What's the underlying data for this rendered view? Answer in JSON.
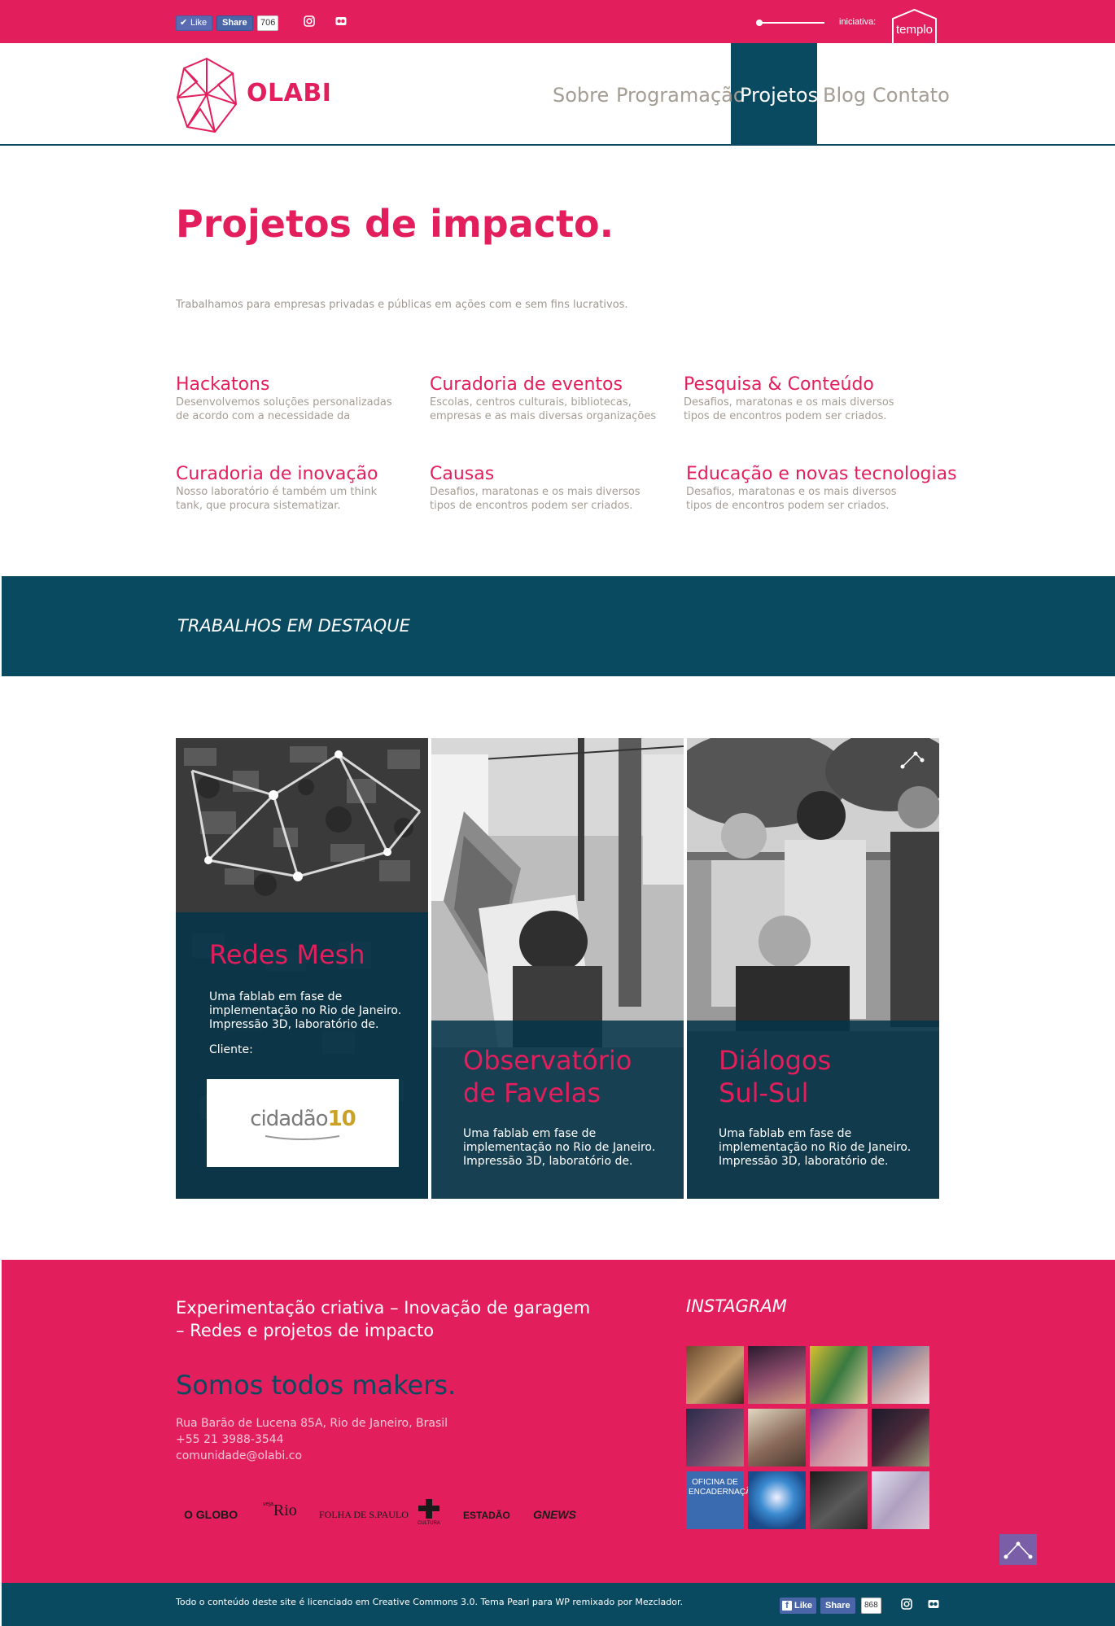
{
  "topbar": {
    "like_label": "Like",
    "share_label": "Share",
    "share_count": "706",
    "initiative_label": "iniciativa:",
    "initiative_logo_text": "templo",
    "icons": [
      "instagram-icon",
      "flickr-icon"
    ],
    "background": "#e31e5c"
  },
  "header": {
    "logo_text": "OLABI",
    "nav": [
      {
        "label": "Sobre",
        "active": false
      },
      {
        "label": "Programação",
        "active": false
      },
      {
        "label": "Projetos",
        "active": true
      },
      {
        "label": "Blog",
        "active": false
      },
      {
        "label": "Contato",
        "active": false
      }
    ],
    "active_color": "#0a4a60"
  },
  "intro": {
    "title": "Projetos de impacto.",
    "subtitle": "Trabalhamos para empresas privadas e públicas em ações com e sem fins lucrativos."
  },
  "services": [
    {
      "title": "Hackatons",
      "desc_lines": [
        "Desenvolvemos soluções personalizadas",
        "de acordo com a necessidade da"
      ]
    },
    {
      "title": "Curadoria de eventos",
      "desc_lines": [
        "Escolas, centros culturais, bibliotecas,",
        "empresas e as mais diversas organizações"
      ]
    },
    {
      "title": "Pesquisa & Conteúdo",
      "desc_lines": [
        "Desafios, maratonas e os mais diversos",
        "tipos de encontros podem ser criados."
      ]
    },
    {
      "title": "Curadoria de inovação",
      "desc_lines": [
        "Nosso laboratório é também um think",
        "tank, que procura sistematizar."
      ]
    },
    {
      "title": "Causas",
      "desc_lines": [
        "Desafios, maratonas e os mais diversos",
        "tipos de encontros podem ser criados."
      ]
    },
    {
      "title": "Educação e novas tecnologias",
      "desc_lines": [
        "Desafios, maratonas e os mais diversos",
        "tipos de encontros podem ser criados."
      ]
    }
  ],
  "featured": {
    "heading": "TRABALHOS EM DESTAQUE",
    "cards": [
      {
        "title_lines": [
          "Redes Mesh"
        ],
        "desc_lines": [
          "Uma fablab em fase de",
          "implementação no Rio de Janeiro.",
          "Impressão 3D, laboratório de."
        ],
        "client_label": "Cliente:",
        "client_logo": {
          "prefix": "cidadão",
          "suffix": "10"
        }
      },
      {
        "title_lines": [
          "Observatório",
          "de Favelas"
        ],
        "desc_lines": [
          "Uma fablab em fase de",
          "implementação no Rio de Janeiro.",
          "Impressão 3D, laboratório de."
        ]
      },
      {
        "title_lines": [
          "Diálogos",
          "Sul-Sul"
        ],
        "desc_lines": [
          "Uma fablab em fase de",
          "implementação no Rio de Janeiro.",
          "Impressão 3D, laboratório de."
        ]
      }
    ]
  },
  "footer": {
    "tagline_lines": [
      "Experimentação criativa – Inovação de garagem",
      "– Redes e projetos de impacto"
    ],
    "makers": "Somos todos makers.",
    "address": "Rua Barão de Lucena 85A, Rio de Janeiro, Brasil",
    "phone": "+55 21 3988-3544",
    "email": "comunidade@olabi.co",
    "press": [
      {
        "name": "O GLOBO",
        "prefix": ""
      },
      {
        "name": "Rio",
        "prefix": "veja"
      },
      {
        "name": "FOLHA DE S.PAULO",
        "prefix": ""
      },
      {
        "name": "CULTURA",
        "prefix": ""
      },
      {
        "name": "ESTADÃO",
        "prefix": ""
      },
      {
        "name": "NEWS",
        "prefix": "G"
      }
    ],
    "instagram_heading": "INSTAGRAM",
    "instagram_posters": [
      [
        "OFICINA DE",
        "ENCADERNAÇÃO"
      ]
    ],
    "background": "#e31e5c"
  },
  "bottombar": {
    "license_text": "Todo o conteúdo deste site é licenciado em Creative Commons 3.0. Tema Pearl para WP remixado por Mezclador.",
    "like_label": "Like",
    "share_label": "Share",
    "share_count": "868",
    "background": "#0a4a60"
  }
}
